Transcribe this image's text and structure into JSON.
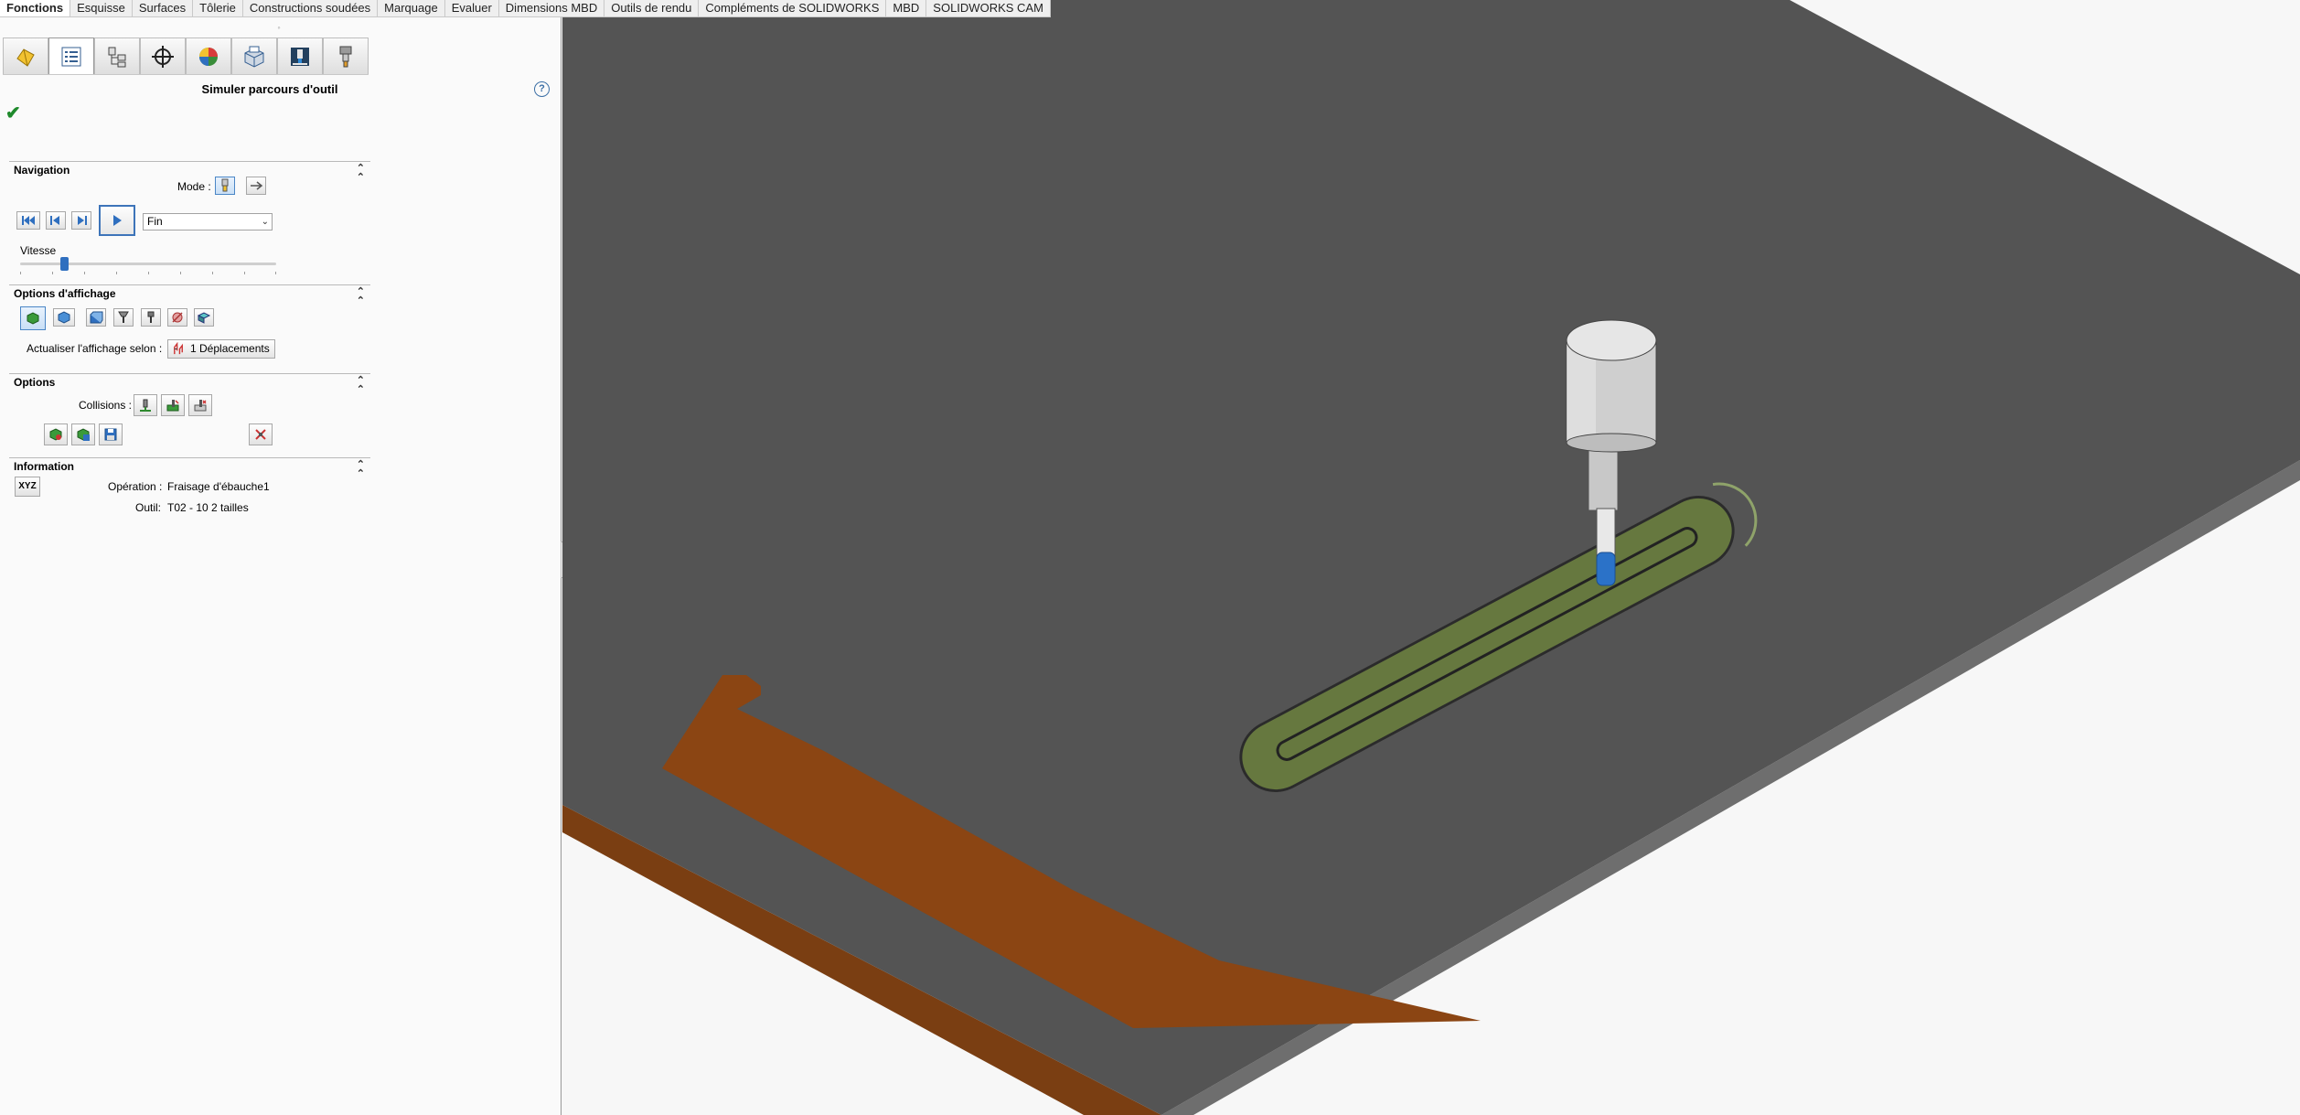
{
  "tabs": [
    "Fonctions",
    "Esquisse",
    "Surfaces",
    "Tôlerie",
    "Constructions soudées",
    "Marquage",
    "Evaluer",
    "Dimensions MBD",
    "Outils de rendu",
    "Compléments de SOLIDWORKS",
    "MBD",
    "SOLIDWORKS CAM"
  ],
  "active_tab": "Fonctions",
  "panel": {
    "title": "Simuler parcours d'outil",
    "help": "?",
    "toolbar_icons": [
      "feature-manager-icon",
      "property-manager-icon",
      "configuration-manager-icon",
      "dimxpert-icon",
      "display-manager-icon",
      "cam-feature-tree-icon",
      "cam-operation-tree-icon",
      "cam-tool-tree-icon"
    ]
  },
  "navigation": {
    "title": "Navigation",
    "mode_label": "Mode :",
    "end_select": "Fin",
    "speed_label": "Vitesse",
    "speed": 0.17
  },
  "display": {
    "title": "Options d'affichage",
    "update_label": "Actualiser l'affichage selon :",
    "update_value": "1 Déplacements"
  },
  "options": {
    "title": "Options",
    "collisions_label": "Collisions :"
  },
  "information": {
    "title": "Information",
    "xyz": "XYZ",
    "operation_label": "Opération :",
    "operation_value": "Fraisage d'ébauche1",
    "tool_label": "Outil:",
    "tool_value": "T02 - 10 2 tailles"
  },
  "colors": {
    "viewport_bg": "#f7f7f7",
    "stock_top": "#545454",
    "stock_side": "#3c3c3c",
    "part_orange": "#8b4513",
    "slot_green": "#6a7d44",
    "tool_blue": "#2b72c8",
    "accent": "#3d74b9"
  }
}
